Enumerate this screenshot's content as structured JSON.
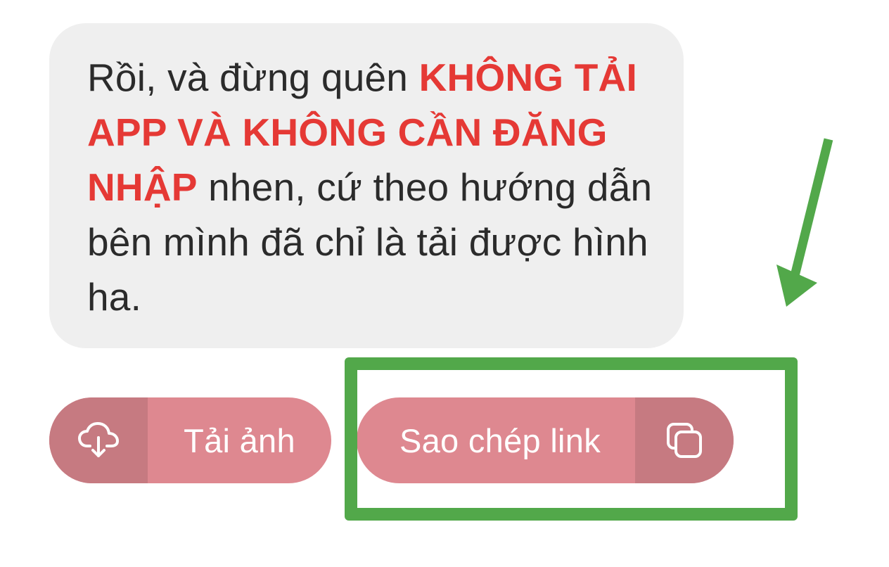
{
  "message": {
    "text_before": "Rồi, và đừng quên ",
    "highlight": "KHÔNG TẢI APP VÀ KHÔNG CẦN ĐĂNG NHẬP",
    "text_after": " nhen, cứ theo hướng dẫn bên mình đã chỉ là tải được hình ha."
  },
  "actions": {
    "download": {
      "label": "Tải ảnh",
      "icon": "cloud-download-icon"
    },
    "copy_link": {
      "label": "Sao chép link",
      "icon": "copy-icon"
    }
  },
  "colors": {
    "bubble_bg": "#efefef",
    "text": "#2b2b2b",
    "highlight_text": "#e53935",
    "button_bg": "#de8890",
    "button_icon_bg": "#c67a81",
    "annotation_green": "#52a84a"
  }
}
